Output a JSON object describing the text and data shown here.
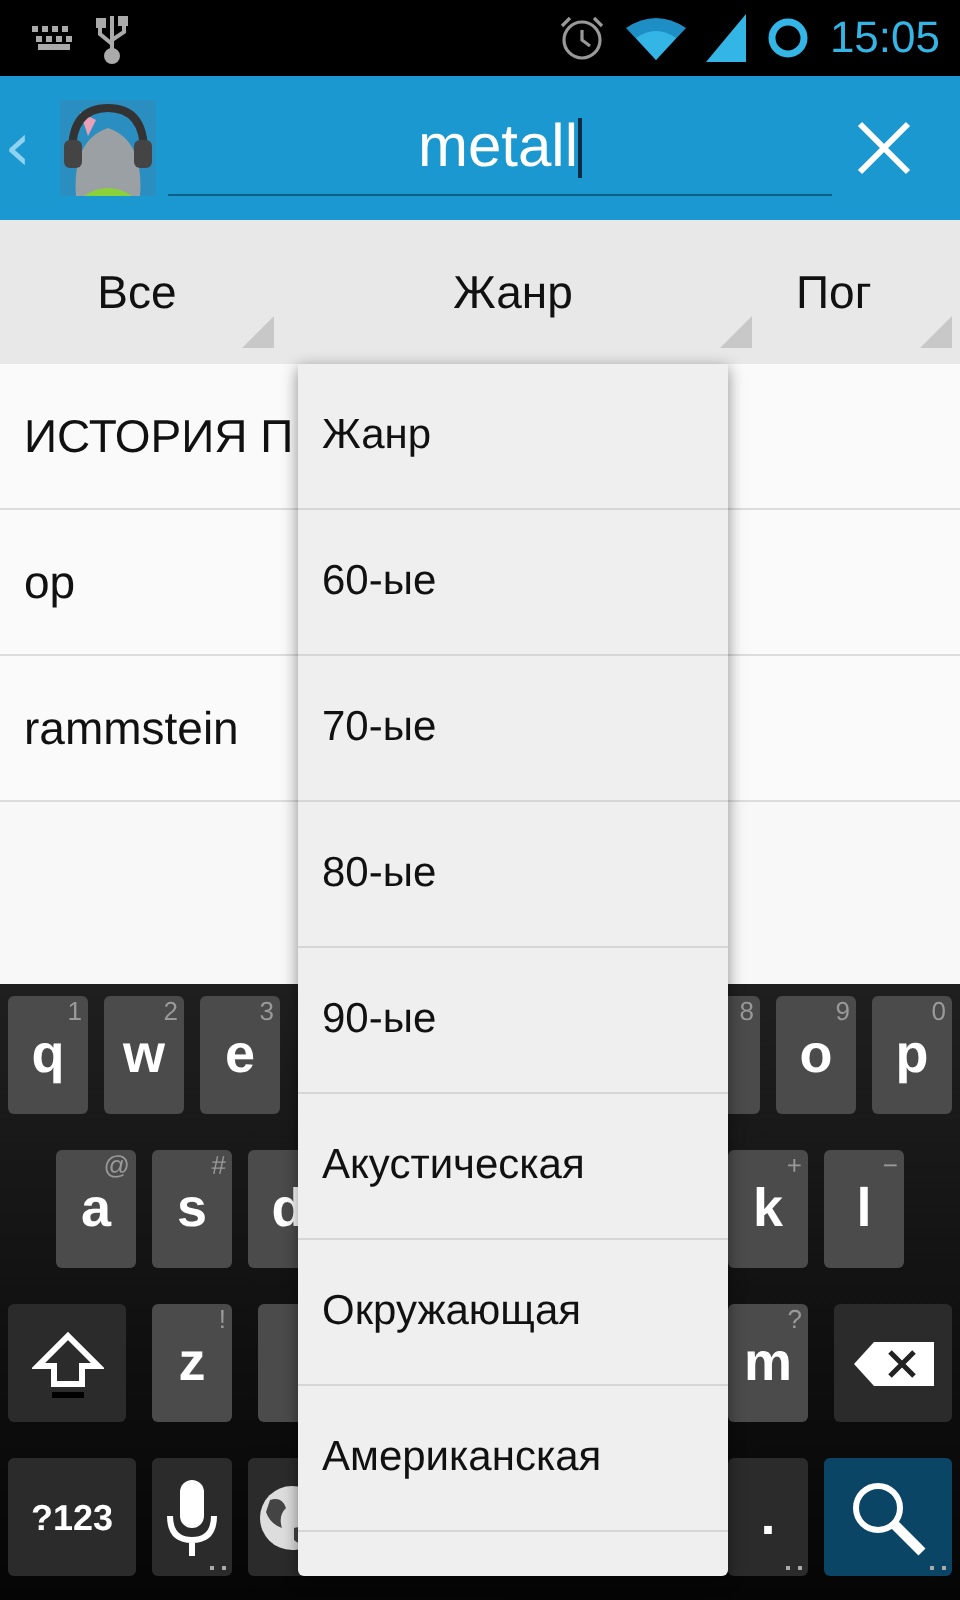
{
  "status_bar": {
    "time": "15:05"
  },
  "action_bar": {
    "back": "‹",
    "search": {
      "value": "metall"
    }
  },
  "filters": [
    {
      "label": "Все"
    },
    {
      "label": "Жанр"
    },
    {
      "label": "Пог"
    }
  ],
  "list": [
    {
      "text": "ИСТОРИЯ П"
    },
    {
      "text": "op"
    },
    {
      "text": "rammstein"
    }
  ],
  "dropdown": {
    "items": [
      "Жанр",
      "60-ые",
      "70-ые",
      "80-ые",
      "90-ые",
      "Акустическая",
      "Окружающая",
      "Американская"
    ]
  },
  "keyboard": [
    {
      "left": [
        {
          "kind": "letter",
          "label": "q",
          "hint": "1"
        },
        {
          "kind": "letter",
          "label": "w",
          "hint": "2"
        },
        {
          "kind": "letter",
          "label": "e",
          "hint": "3"
        }
      ],
      "right": [
        {
          "kind": "letter",
          "hint": "8"
        },
        {
          "kind": "letter",
          "label": "o",
          "hint": "9"
        },
        {
          "kind": "letter",
          "label": "p",
          "hint": "0"
        }
      ]
    },
    {
      "left": [
        {
          "kind": "letter",
          "label": "a",
          "hint": "@"
        },
        {
          "kind": "letter",
          "label": "s",
          "hint": "#"
        },
        {
          "kind": "letter",
          "label": "d"
        }
      ],
      "right": [
        {
          "kind": "letter",
          "label": "k",
          "hint": "+"
        },
        {
          "kind": "letter",
          "label": "l",
          "hint": "−"
        }
      ]
    },
    {
      "left": [
        {
          "kind": "shift"
        },
        {
          "kind": "letter",
          "label": "z",
          "hint": "!"
        },
        {
          "kind": "letter"
        }
      ],
      "right": [
        {
          "kind": "letter",
          "label": "m",
          "hint": "?"
        },
        {
          "kind": "backspace"
        }
      ]
    },
    {
      "left": [
        {
          "kind": "symbols",
          "label": "?123"
        },
        {
          "kind": "mic"
        },
        {
          "kind": "globe"
        }
      ],
      "right": [
        {
          "kind": "period",
          "label": "."
        },
        {
          "kind": "search"
        }
      ]
    }
  ]
}
